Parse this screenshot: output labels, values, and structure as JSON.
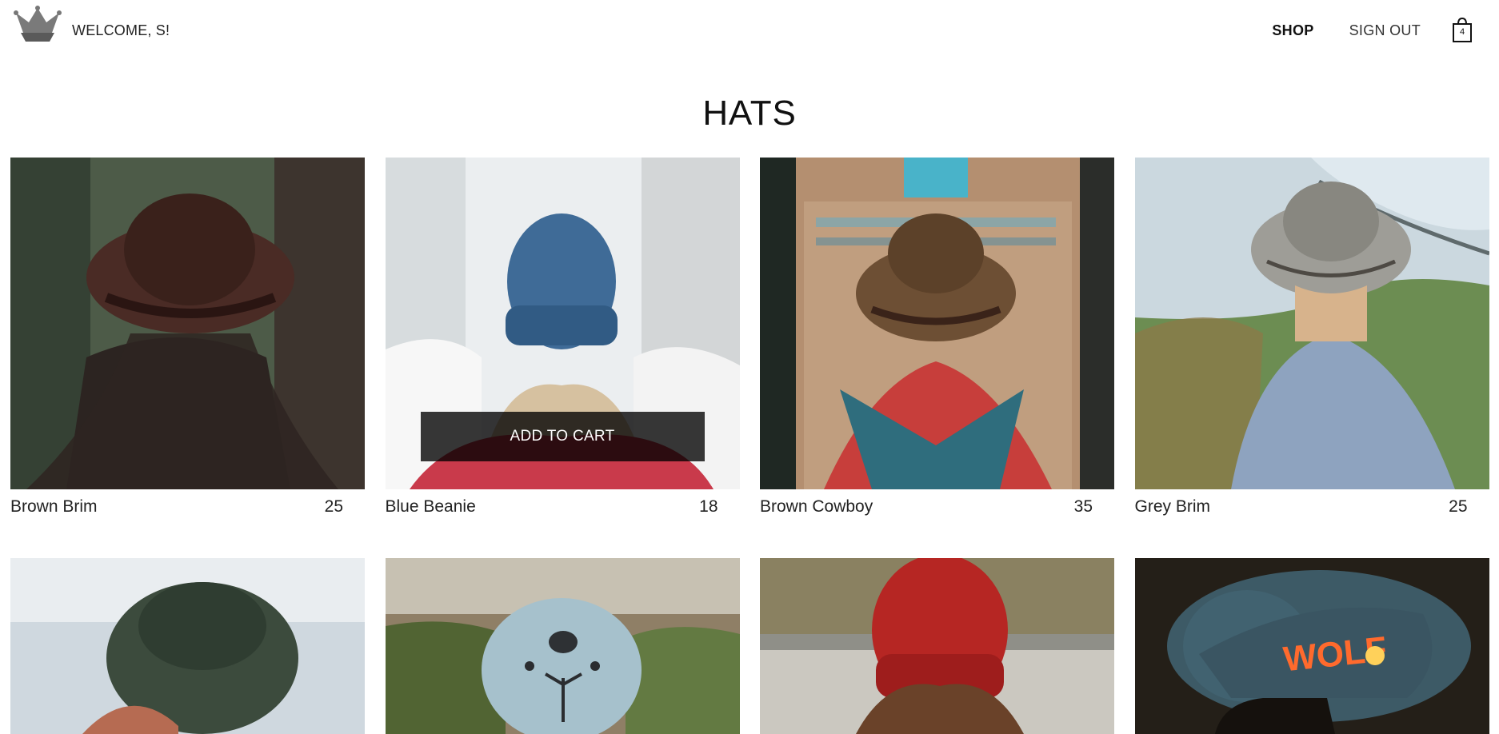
{
  "header": {
    "logo": {
      "icon": "crown-icon"
    },
    "welcome_text": "WELCOME, S!",
    "nav": [
      {
        "label": "SHOP",
        "active": true
      },
      {
        "label": "SIGN OUT",
        "active": false
      }
    ],
    "cart": {
      "icon": "shopping-bag-icon",
      "count": "4"
    }
  },
  "collection": {
    "title": "HATS",
    "products": [
      {
        "name": "Brown Brim",
        "price": "25",
        "theme": {
          "bg": "#4c5a4a",
          "hat": "#3f2620",
          "hair": "#2a211b"
        }
      },
      {
        "name": "Blue Beanie",
        "price": "18",
        "theme": {
          "bg": "#e8ecef",
          "hat": "#3f6b97",
          "hair": "#c9b28f"
        },
        "hover": true
      },
      {
        "name": "Brown Cowboy",
        "price": "35",
        "theme": {
          "bg": "#b38b68",
          "hat": "#6d4f34",
          "scarf": "#2f6d7d"
        }
      },
      {
        "name": "Grey Brim",
        "price": "25",
        "theme": {
          "bg": "#6d8b54",
          "hat": "#9b9b94",
          "shirt": "#8ea3bf"
        }
      }
    ],
    "second_row": [
      {
        "theme": {
          "bg": "#cfd8e0",
          "hat": "#3d4c3e"
        }
      },
      {
        "theme": {
          "bg": "#7b6f5c",
          "hat": "#a6c1cc"
        }
      },
      {
        "theme": {
          "bg": "#8d8f87",
          "hat": "#b62623"
        }
      },
      {
        "theme": {
          "bg": "#2a241d",
          "hat": "#3d5a66",
          "logo_text": "WOLF"
        }
      }
    ],
    "hover_button_label": "ADD TO CART"
  }
}
